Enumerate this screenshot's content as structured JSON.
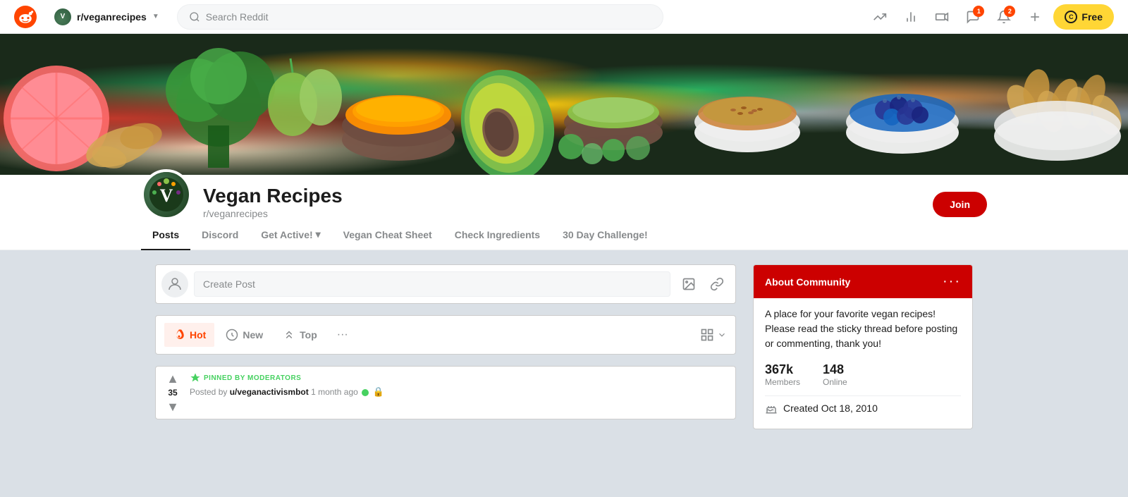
{
  "navbar": {
    "logo_text": "reddit",
    "subreddit": "r/veganrecipes",
    "search_placeholder": "Search Reddit",
    "notifications_chat_badge": "1",
    "notifications_bell_badge": "2",
    "btn_free_label": "Free",
    "btn_free_circle": "C"
  },
  "banner": {
    "alt": "Vegan food banner with vegetables, spices, fruits"
  },
  "community": {
    "name": "Vegan Recipes",
    "handle": "r/veganrecipes",
    "join_label": "Join",
    "avatar_letter": "V"
  },
  "tabs": [
    {
      "id": "posts",
      "label": "Posts",
      "active": true
    },
    {
      "id": "discord",
      "label": "Discord",
      "active": false
    },
    {
      "id": "get-active",
      "label": "Get Active!",
      "active": false,
      "has_dropdown": true
    },
    {
      "id": "vegan-cheat-sheet",
      "label": "Vegan Cheat Sheet",
      "active": false
    },
    {
      "id": "check-ingredients",
      "label": "Check Ingredients",
      "active": false
    },
    {
      "id": "30-day-challenge",
      "label": "30 Day Challenge!",
      "active": false
    }
  ],
  "create_post": {
    "placeholder": "Create Post",
    "image_icon": "🖼",
    "link_icon": "🔗"
  },
  "sort": {
    "hot_label": "Hot",
    "new_label": "New",
    "top_label": "Top",
    "more_label": "···"
  },
  "post": {
    "pinned_label": "PINNED BY MODERATORS",
    "vote_count": "35",
    "meta_text": "Posted by u/veganactivismbot 1 month ago",
    "indicators": "🟢 🔒"
  },
  "about": {
    "header_title": "About Community",
    "description": "A place for your favorite vegan recipes! Please read the sticky thread before posting or commenting, thank you!",
    "members_value": "367k",
    "members_label": "Members",
    "online_value": "148",
    "online_label": "Online",
    "created_text": "Created Oct 18, 2010"
  }
}
